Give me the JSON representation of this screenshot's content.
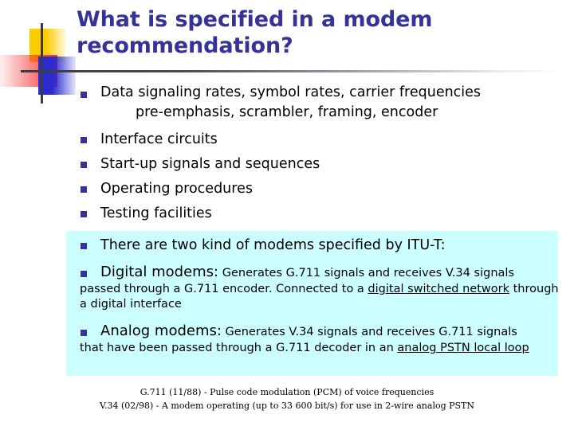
{
  "slide": {
    "title": "What is specified in a modem recommendation?",
    "colors": {
      "title_text": "#333399",
      "bullet_marker": "#333399",
      "highlight_background": "#CCFFFF",
      "body_text": "#000000",
      "logo_yellow": "#FFCC00",
      "logo_red": "#F03030",
      "logo_blue": "#2B2BD0",
      "logo_line": "#3b3b44",
      "slide_background": "#FFFFFF"
    }
  },
  "logo": {
    "yellow_square": "yellow-square",
    "red_rectangle": "red-gradient-rectangle",
    "blue_square": "blue-gradient-square",
    "vertical_line": "vertical-rule",
    "horizontal_line": "horizontal-rule"
  },
  "bullets": [
    {
      "line_1": "Data signaling rates, symbol rates, carrier frequencies",
      "line_2": "pre-emphasis, scrambler, framing, encoder"
    },
    {
      "line_1": "Interface circuits"
    },
    {
      "line_1": "Start-up signals and sequences"
    },
    {
      "line_1": "Operating procedures"
    },
    {
      "line_1": "Testing facilities"
    }
  ],
  "highlighted": {
    "intro": "There are two kind of modems specified by ITU-T:",
    "items": [
      {
        "term": "Digital modems:",
        "detail_1": " Generates G.711 signals and receives V.34 signals",
        "detail_2": "passed through a G.711 encoder. Connected to a ",
        "detail_underlined": "digital switched network",
        "detail_3": " through a digital interface"
      },
      {
        "term": "Analog modems:",
        "detail_1": " Generates V.34 signals and receives G.711 signals",
        "detail_2": "that have been passed through a G.711 decoder in an ",
        "detail_underlined": "analog PSTN local loop",
        "detail_3": ""
      }
    ]
  },
  "footnote": {
    "line_1": "G.711 (11/88) - Pulse code modulation (PCM) of voice frequencies",
    "line_2": "V.34 (02/98) - A modem operating (up to 33 600 bit/s) for use in 2-wire analog PSTN"
  }
}
